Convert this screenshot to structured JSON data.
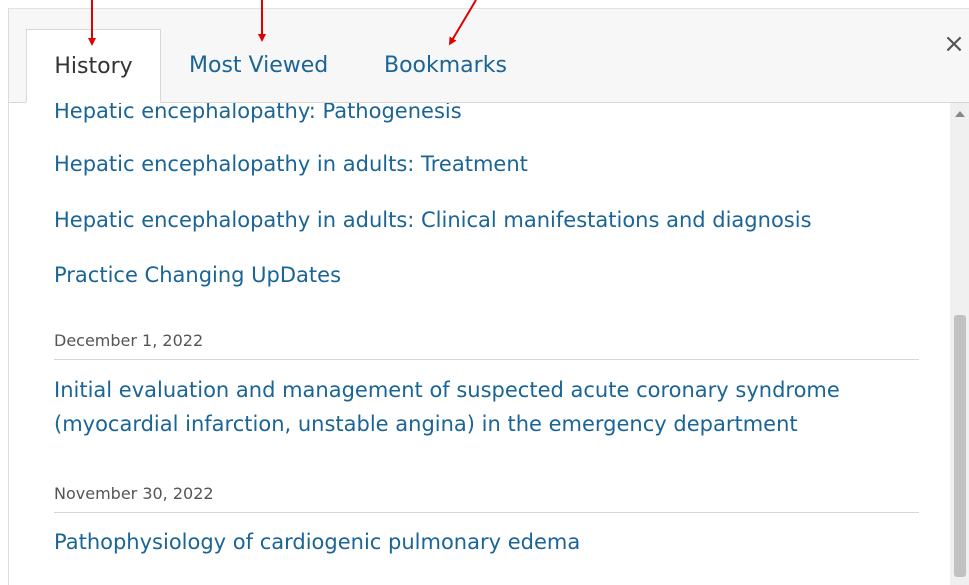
{
  "tabs": [
    {
      "label": "History",
      "active": true
    },
    {
      "label": "Most Viewed",
      "active": false
    },
    {
      "label": "Bookmarks",
      "active": false
    }
  ],
  "close_label": "×",
  "items": {
    "i0": "Hepatic encephalopathy: Pathogenesis",
    "i1": "Hepatic encephalopathy in adults: Treatment",
    "i2": "Hepatic encephalopathy in adults: Clinical manifestations and diagnosis",
    "i3": "Practice Changing UpDates",
    "d1": "December 1, 2022",
    "i4": "Initial evaluation and management of suspected acute coronary syndrome (myocardial infarction, unstable angina) in the emergency department",
    "d2": "November 30, 2022",
    "i5": "Pathophysiology of cardiogenic pulmonary edema"
  },
  "colors": {
    "link": "#1a6496",
    "annotation_arrow": "#e00000"
  }
}
